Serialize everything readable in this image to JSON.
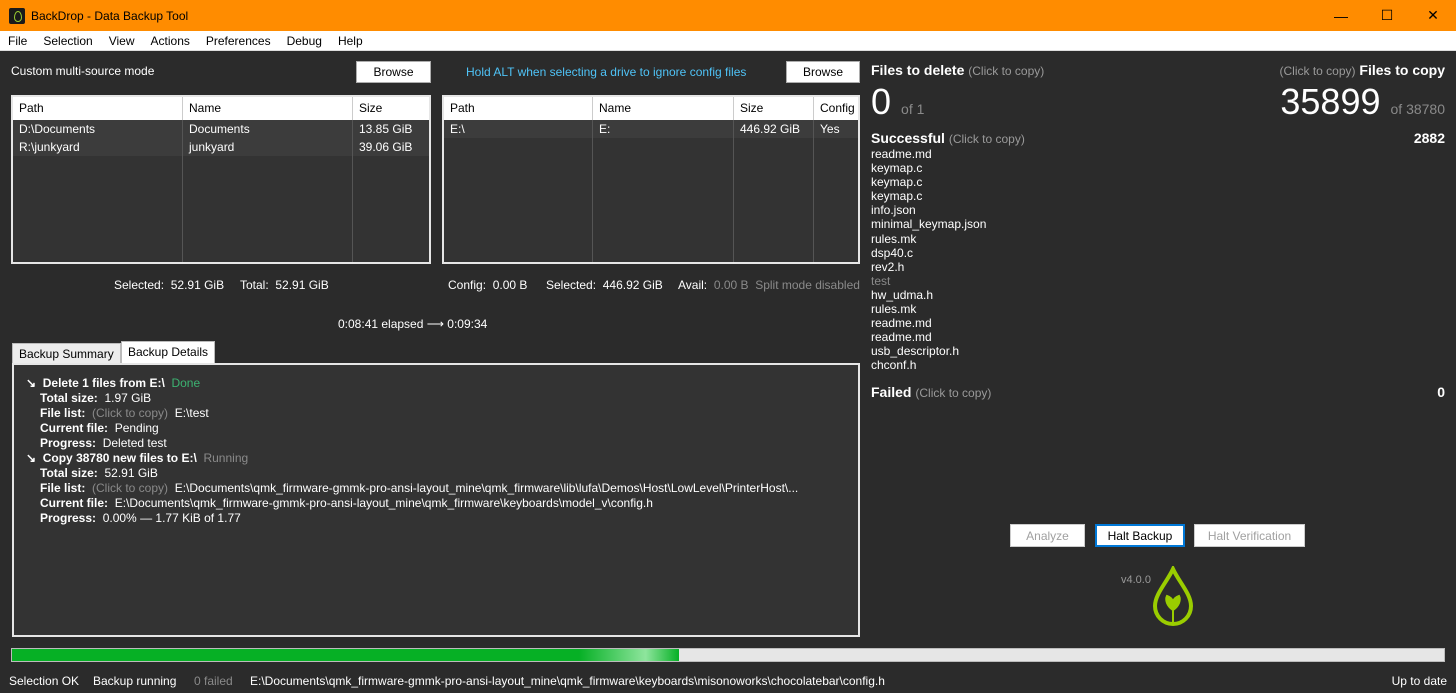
{
  "window": {
    "title": "BackDrop - Data Backup Tool",
    "minimize": "—",
    "maximize": "☐",
    "close": "✕"
  },
  "menu": [
    "File",
    "Selection",
    "View",
    "Actions",
    "Preferences",
    "Debug",
    "Help"
  ],
  "source": {
    "mode_label": "Custom multi-source mode",
    "browse": "Browse",
    "columns": [
      "Path",
      "Name",
      "Size"
    ],
    "rows": [
      [
        "D:\\Documents",
        "Documents",
        "13.85 GiB"
      ],
      [
        "R:\\junkyard",
        "junkyard",
        "39.06 GiB"
      ]
    ],
    "selected_label": "Selected:",
    "selected_value": "52.91 GiB",
    "total_label": "Total:",
    "total_value": "52.91 GiB"
  },
  "dest": {
    "hint": "Hold ALT when selecting a drive to ignore config files",
    "browse": "Browse",
    "columns": [
      "Path",
      "Name",
      "Size",
      "Config"
    ],
    "rows": [
      [
        "E:\\",
        "E:",
        "446.92 GiB",
        "Yes"
      ]
    ],
    "config_label": "Config:",
    "config_value": "0.00 B",
    "selected_label": "Selected:",
    "selected_value": "446.92 GiB",
    "avail_label": "Avail:",
    "avail_value": "0.00 B",
    "split_mode": "Split mode disabled"
  },
  "elapsed": "0:08:41 elapsed ⟶ 0:09:34",
  "tabs": [
    "Backup Summary",
    "Backup Details"
  ],
  "details": {
    "arrow": "↘",
    "delete_title": "Delete 1 files from E:\\",
    "delete_status": "Done",
    "total_size_label": "Total size:",
    "delete_total": "1.97 GiB",
    "file_list_label": "File list:",
    "click_to_copy": "(Click to copy)",
    "delete_file_list": "E:\\test",
    "current_file_label": "Current file:",
    "delete_current": "Pending",
    "progress_label": "Progress:",
    "delete_progress": "Deleted test",
    "copy_title": "Copy 38780 new files to E:\\",
    "copy_status": "Running",
    "copy_total": "52.91 GiB",
    "copy_file_list": "E:\\Documents\\qmk_firmware-gmmk-pro-ansi-layout_mine\\qmk_firmware\\lib\\lufa\\Demos\\Host\\LowLevel\\PrinterHost\\...",
    "copy_current": "E:\\Documents\\qmk_firmware-gmmk-pro-ansi-layout_mine\\qmk_firmware\\keyboards\\model_v\\config.h",
    "copy_progress": "0.00% — 1.77 KiB of 1.77"
  },
  "right": {
    "delete_title": "Files to delete",
    "click_to_copy": "(Click to copy)",
    "delete_count": "0",
    "delete_of": "of 1",
    "copy_title": "Files to copy",
    "copy_count": "35899",
    "copy_of": "of 38780",
    "success_title": "Successful",
    "success_count": "2882",
    "files": [
      "readme.md",
      "keymap.c",
      "keymap.c",
      "keymap.c",
      "info.json",
      "minimal_keymap.json",
      "rules.mk",
      "dsp40.c",
      "rev2.h",
      "test",
      "hw_udma.h",
      "rules.mk",
      "readme.md",
      "readme.md",
      "usb_descriptor.h",
      "chconf.h"
    ],
    "failed_title": "Failed",
    "failed_count": "0",
    "analyze": "Analyze",
    "halt_backup": "Halt Backup",
    "halt_verification": "Halt Verification",
    "version": "v4.0.0"
  },
  "progress": {
    "fraction": 0.466
  },
  "status": {
    "selection": "Selection OK",
    "backup": "Backup running",
    "failed": "0 failed",
    "current": "E:\\Documents\\qmk_firmware-gmmk-pro-ansi-layout_mine\\qmk_firmware\\keyboards\\misonoworks\\chocolatebar\\config.h",
    "update": "Up to date"
  }
}
